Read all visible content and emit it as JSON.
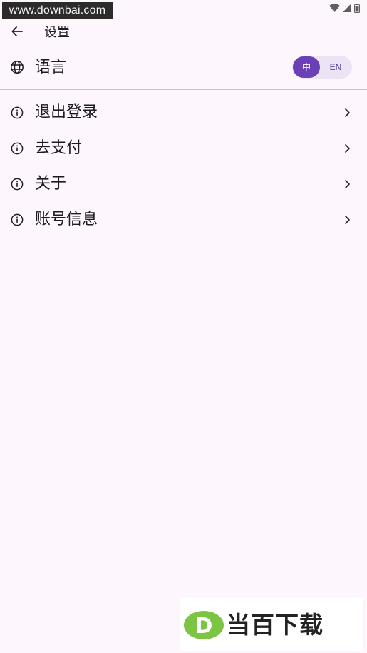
{
  "status_bar": {
    "watermark_text": "www.downbai.com",
    "icons": [
      "wifi-icon",
      "signal-icon",
      "battery-icon"
    ]
  },
  "app_bar": {
    "back_icon": "arrow-left-icon",
    "title": "设置"
  },
  "language": {
    "icon": "globe-icon",
    "label": "语言",
    "options": [
      "中",
      "EN"
    ],
    "selected": "中"
  },
  "menu": {
    "items": [
      {
        "icon": "info-icon",
        "label": "退出登录"
      },
      {
        "icon": "info-icon",
        "label": "去支付"
      },
      {
        "icon": "info-icon",
        "label": "关于"
      },
      {
        "icon": "info-icon",
        "label": "账号信息"
      }
    ]
  },
  "watermark_bottom": {
    "logo_letter": "D",
    "text": "当百下载"
  },
  "colors": {
    "background": "#fdf7fd",
    "accent": "#6b3fb5",
    "toggle_track": "#ece3f4",
    "text": "#1c1b1f",
    "logo_green": "#7cc443"
  }
}
